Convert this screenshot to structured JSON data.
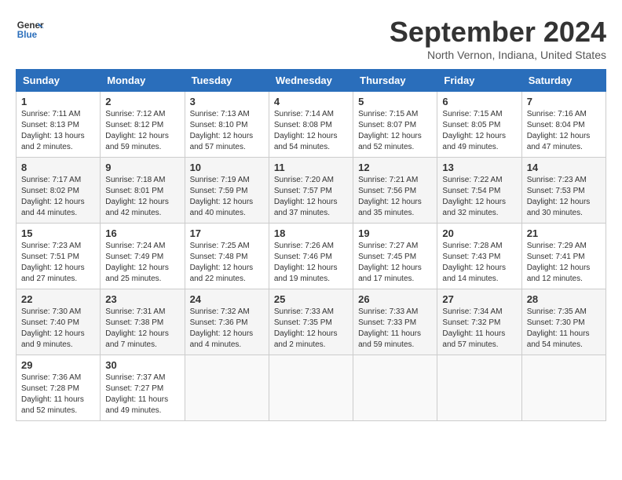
{
  "header": {
    "logo_line1": "General",
    "logo_line2": "Blue",
    "title": "September 2024",
    "subtitle": "North Vernon, Indiana, United States"
  },
  "columns": [
    "Sunday",
    "Monday",
    "Tuesday",
    "Wednesday",
    "Thursday",
    "Friday",
    "Saturday"
  ],
  "weeks": [
    [
      {
        "day": "1",
        "info": "Sunrise: 7:11 AM\nSunset: 8:13 PM\nDaylight: 13 hours\nand 2 minutes."
      },
      {
        "day": "2",
        "info": "Sunrise: 7:12 AM\nSunset: 8:12 PM\nDaylight: 12 hours\nand 59 minutes."
      },
      {
        "day": "3",
        "info": "Sunrise: 7:13 AM\nSunset: 8:10 PM\nDaylight: 12 hours\nand 57 minutes."
      },
      {
        "day": "4",
        "info": "Sunrise: 7:14 AM\nSunset: 8:08 PM\nDaylight: 12 hours\nand 54 minutes."
      },
      {
        "day": "5",
        "info": "Sunrise: 7:15 AM\nSunset: 8:07 PM\nDaylight: 12 hours\nand 52 minutes."
      },
      {
        "day": "6",
        "info": "Sunrise: 7:15 AM\nSunset: 8:05 PM\nDaylight: 12 hours\nand 49 minutes."
      },
      {
        "day": "7",
        "info": "Sunrise: 7:16 AM\nSunset: 8:04 PM\nDaylight: 12 hours\nand 47 minutes."
      }
    ],
    [
      {
        "day": "8",
        "info": "Sunrise: 7:17 AM\nSunset: 8:02 PM\nDaylight: 12 hours\nand 44 minutes."
      },
      {
        "day": "9",
        "info": "Sunrise: 7:18 AM\nSunset: 8:01 PM\nDaylight: 12 hours\nand 42 minutes."
      },
      {
        "day": "10",
        "info": "Sunrise: 7:19 AM\nSunset: 7:59 PM\nDaylight: 12 hours\nand 40 minutes."
      },
      {
        "day": "11",
        "info": "Sunrise: 7:20 AM\nSunset: 7:57 PM\nDaylight: 12 hours\nand 37 minutes."
      },
      {
        "day": "12",
        "info": "Sunrise: 7:21 AM\nSunset: 7:56 PM\nDaylight: 12 hours\nand 35 minutes."
      },
      {
        "day": "13",
        "info": "Sunrise: 7:22 AM\nSunset: 7:54 PM\nDaylight: 12 hours\nand 32 minutes."
      },
      {
        "day": "14",
        "info": "Sunrise: 7:23 AM\nSunset: 7:53 PM\nDaylight: 12 hours\nand 30 minutes."
      }
    ],
    [
      {
        "day": "15",
        "info": "Sunrise: 7:23 AM\nSunset: 7:51 PM\nDaylight: 12 hours\nand 27 minutes."
      },
      {
        "day": "16",
        "info": "Sunrise: 7:24 AM\nSunset: 7:49 PM\nDaylight: 12 hours\nand 25 minutes."
      },
      {
        "day": "17",
        "info": "Sunrise: 7:25 AM\nSunset: 7:48 PM\nDaylight: 12 hours\nand 22 minutes."
      },
      {
        "day": "18",
        "info": "Sunrise: 7:26 AM\nSunset: 7:46 PM\nDaylight: 12 hours\nand 19 minutes."
      },
      {
        "day": "19",
        "info": "Sunrise: 7:27 AM\nSunset: 7:45 PM\nDaylight: 12 hours\nand 17 minutes."
      },
      {
        "day": "20",
        "info": "Sunrise: 7:28 AM\nSunset: 7:43 PM\nDaylight: 12 hours\nand 14 minutes."
      },
      {
        "day": "21",
        "info": "Sunrise: 7:29 AM\nSunset: 7:41 PM\nDaylight: 12 hours\nand 12 minutes."
      }
    ],
    [
      {
        "day": "22",
        "info": "Sunrise: 7:30 AM\nSunset: 7:40 PM\nDaylight: 12 hours\nand 9 minutes."
      },
      {
        "day": "23",
        "info": "Sunrise: 7:31 AM\nSunset: 7:38 PM\nDaylight: 12 hours\nand 7 minutes."
      },
      {
        "day": "24",
        "info": "Sunrise: 7:32 AM\nSunset: 7:36 PM\nDaylight: 12 hours\nand 4 minutes."
      },
      {
        "day": "25",
        "info": "Sunrise: 7:33 AM\nSunset: 7:35 PM\nDaylight: 12 hours\nand 2 minutes."
      },
      {
        "day": "26",
        "info": "Sunrise: 7:33 AM\nSunset: 7:33 PM\nDaylight: 11 hours\nand 59 minutes."
      },
      {
        "day": "27",
        "info": "Sunrise: 7:34 AM\nSunset: 7:32 PM\nDaylight: 11 hours\nand 57 minutes."
      },
      {
        "day": "28",
        "info": "Sunrise: 7:35 AM\nSunset: 7:30 PM\nDaylight: 11 hours\nand 54 minutes."
      }
    ],
    [
      {
        "day": "29",
        "info": "Sunrise: 7:36 AM\nSunset: 7:28 PM\nDaylight: 11 hours\nand 52 minutes."
      },
      {
        "day": "30",
        "info": "Sunrise: 7:37 AM\nSunset: 7:27 PM\nDaylight: 11 hours\nand 49 minutes."
      },
      null,
      null,
      null,
      null,
      null
    ]
  ]
}
